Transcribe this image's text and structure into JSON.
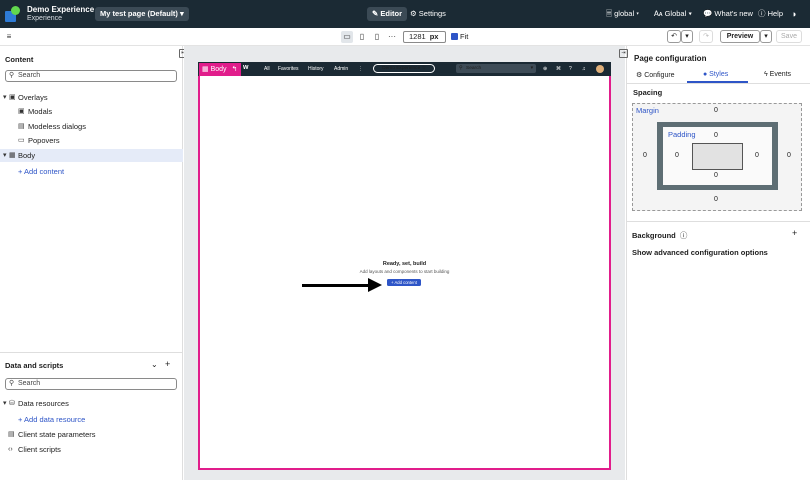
{
  "header": {
    "app_title": "Demo Experience",
    "app_subtitle": "Experience",
    "page_select": "My test page (Default) ▾",
    "tab_editor": "✎ Editor",
    "tab_settings": "⚙ Settings",
    "scope": "🗏 global ▾",
    "language": "🗛 Global ▾",
    "whats_new": "💬 What's new",
    "help": "ⓘ Help",
    "theme_icon": "◑"
  },
  "toolbar": {
    "width_value": "1281",
    "width_unit": "px",
    "fit_label": "Fit",
    "preview_label": "Preview",
    "save_label": "Save"
  },
  "content_panel": {
    "title": "Content",
    "search_placeholder": "Search",
    "overlays": "Overlays",
    "modals": "Modals",
    "modeless_dialogs": "Modeless dialogs",
    "popovers": "Popovers",
    "body": "Body",
    "add_content": "+ Add content"
  },
  "data_panel": {
    "title": "Data and scripts",
    "search_placeholder": "Search",
    "data_resources": "Data resources",
    "add_data_resource": "+ Add data resource",
    "client_state_parameters": "Client state parameters",
    "client_scripts": "Client scripts"
  },
  "canvas": {
    "body_tag": "Body",
    "nav_logo": "w",
    "nav_items": [
      "All",
      "Favorites",
      "History",
      "Admin",
      "⋮"
    ],
    "demo_pill": "Demo Experience ☆",
    "site_search": "Search",
    "empty_title": "Ready, set, build",
    "empty_subtitle": "Add layouts and components to start building",
    "add_content_button": "+ Add content"
  },
  "right_panel": {
    "title": "Page configuration",
    "tab_configure": "⚙ Configure",
    "tab_styles": "● Styles",
    "tab_events": "ϟ Events",
    "spacing_label": "Spacing",
    "margin_label": "Margin",
    "padding_label": "Padding",
    "margin_top": "0",
    "margin_right": "0",
    "margin_bottom": "0",
    "margin_left": "0",
    "padding_top": "0",
    "padding_right": "0",
    "padding_bottom": "0",
    "padding_left": "0",
    "background_label": "Background",
    "advanced_options": "Show advanced configuration options"
  },
  "colors": {
    "accent": "#2e55c7",
    "selection": "#e11d8b",
    "header_bg": "#1b2a34"
  }
}
